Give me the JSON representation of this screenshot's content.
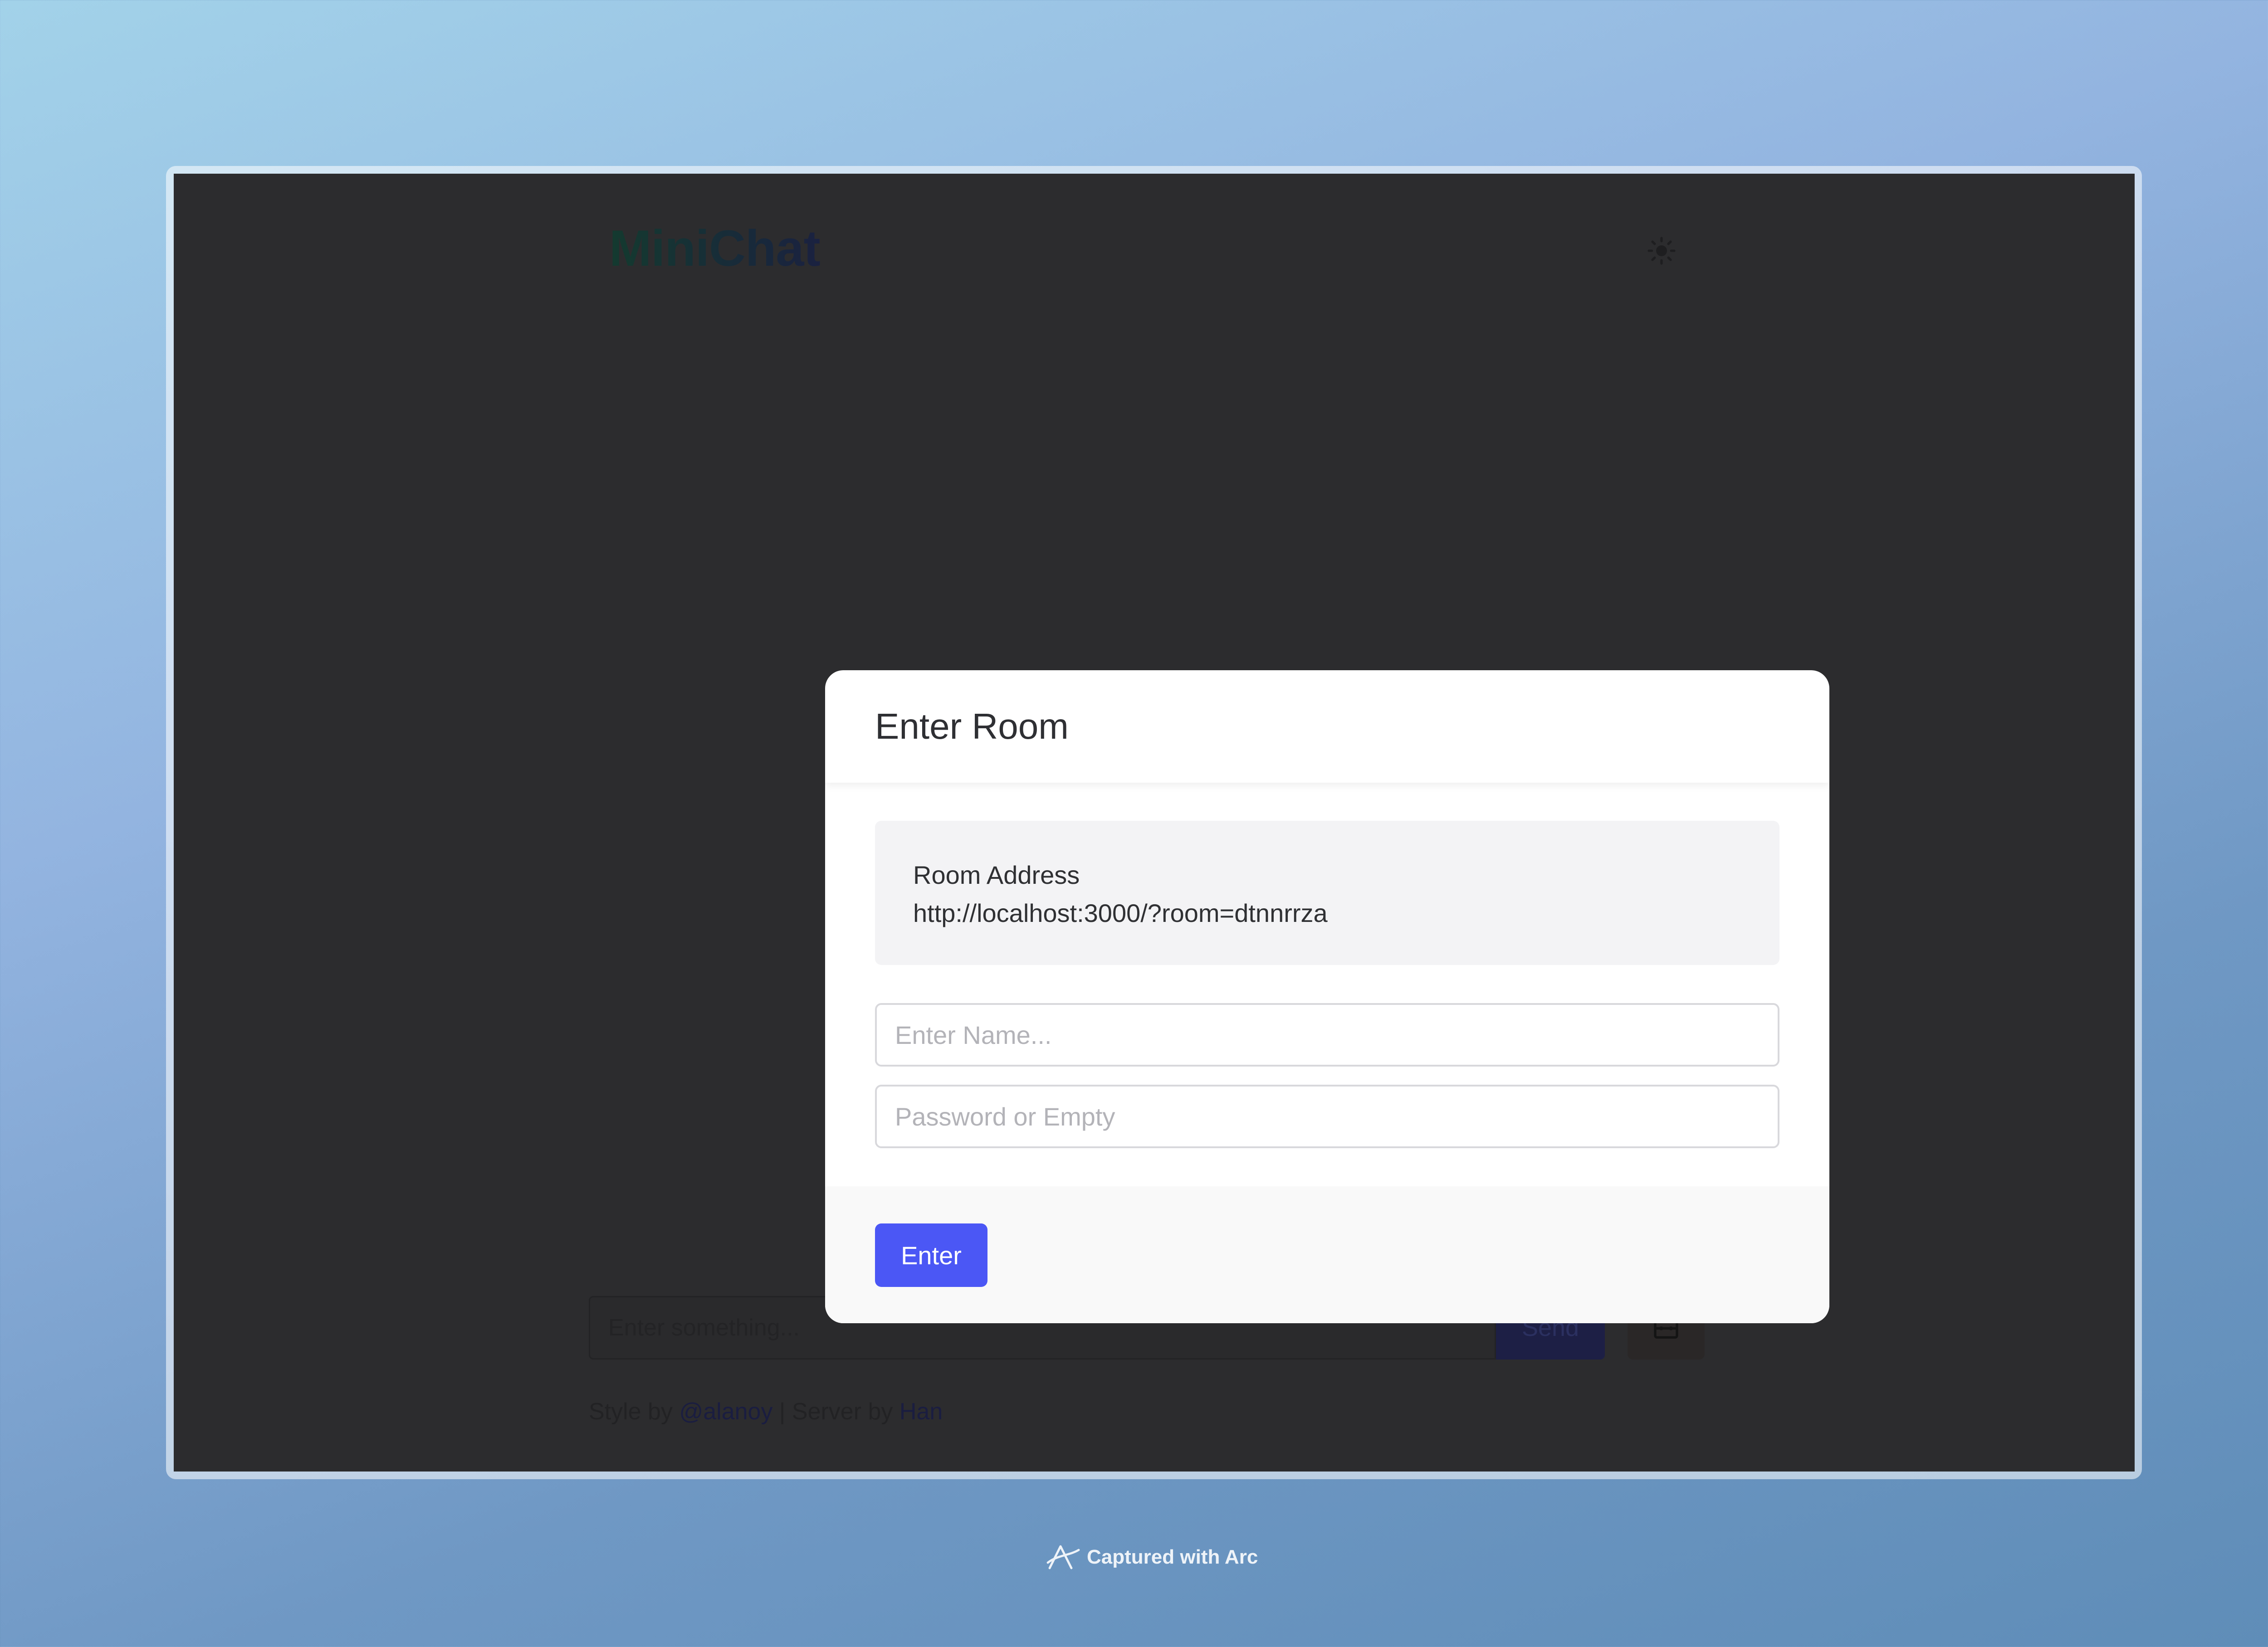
{
  "app": {
    "title": "MiniChat",
    "theme_icon": "sun-icon"
  },
  "chat": {
    "placeholder": "Enter something...",
    "send_label": "Send",
    "tools_icon": "toolbox-icon"
  },
  "footer": {
    "style_prefix": "Style by",
    "style_author": "@alanoy",
    "separator": "|",
    "server_prefix": "Server by",
    "server_author": "Han"
  },
  "modal": {
    "title": "Enter Room",
    "address_label": "Room Address",
    "address_value": "http://localhost:3000/?room=dtnnrrza",
    "name_placeholder": "Enter Name...",
    "password_placeholder": "Password or Empty",
    "enter_label": "Enter"
  },
  "capture": {
    "label": "Captured with Arc",
    "icon": "arc-logo-icon"
  },
  "colors": {
    "app_background": "#2c2c2e",
    "modal_background": "#ffffff",
    "accent": "#4b57f5"
  }
}
